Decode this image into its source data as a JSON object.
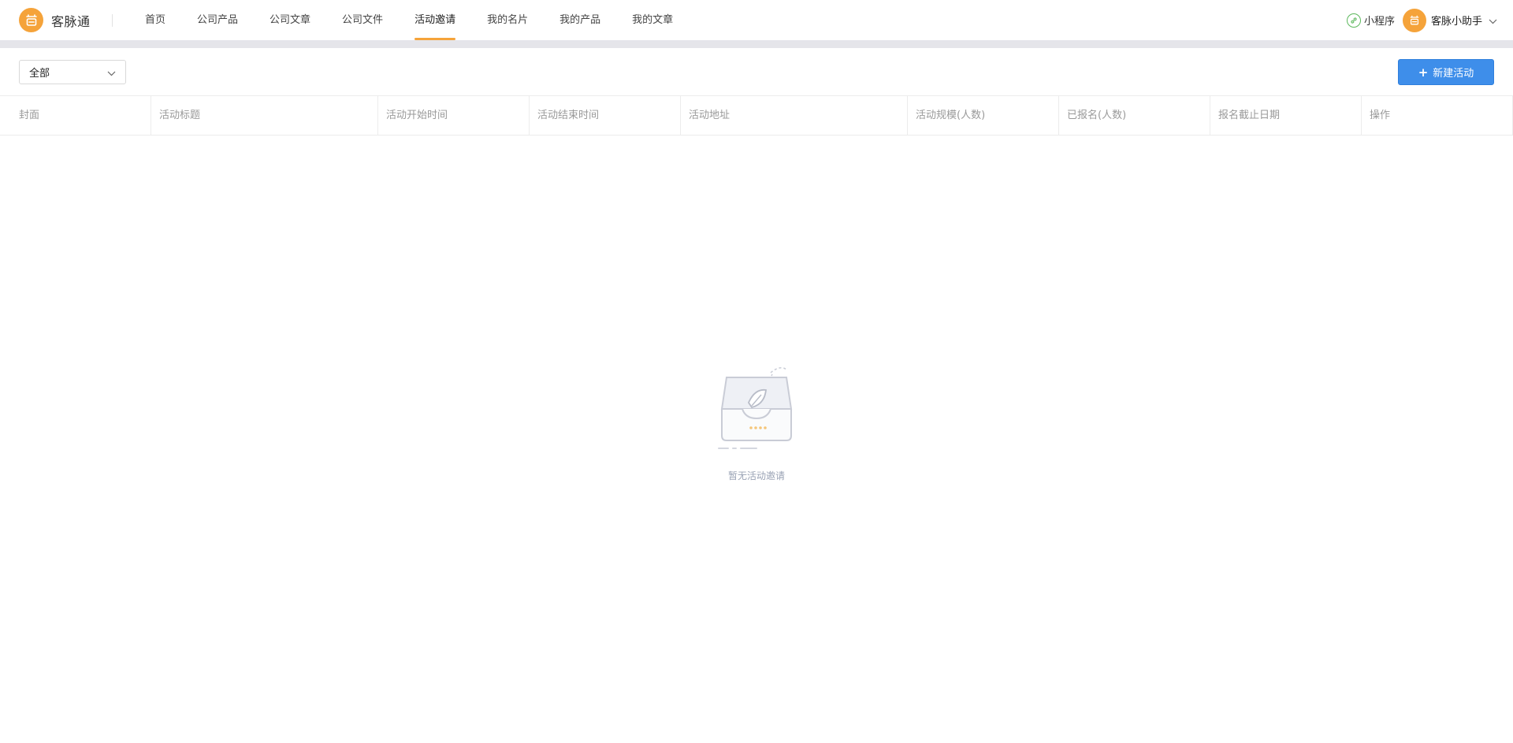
{
  "brand": {
    "name": "客脉通",
    "logo_icon": "logo-icon"
  },
  "nav": {
    "items": [
      {
        "label": "首页",
        "active": false
      },
      {
        "label": "公司产品",
        "active": false
      },
      {
        "label": "公司文章",
        "active": false
      },
      {
        "label": "公司文件",
        "active": false
      },
      {
        "label": "活动邀请",
        "active": true
      },
      {
        "label": "我的名片",
        "active": false
      },
      {
        "label": "我的产品",
        "active": false
      },
      {
        "label": "我的文章",
        "active": false
      }
    ]
  },
  "header_right": {
    "mini_app_label": "小程序",
    "user_name": "客脉小助手"
  },
  "filter": {
    "selected": "全部"
  },
  "toolbar": {
    "new_button_label": "新建活动"
  },
  "table": {
    "columns": [
      "封面",
      "活动标题",
      "活动开始时间",
      "活动结束时间",
      "活动地址",
      "活动规模(人数)",
      "已报名(人数)",
      "报名截止日期",
      "操作"
    ],
    "rows": []
  },
  "empty_state": {
    "text": "暂无活动邀请"
  },
  "colors": {
    "accent": "#f5a33a",
    "primary": "#3e8eea",
    "mini_app": "#5cb85c"
  }
}
